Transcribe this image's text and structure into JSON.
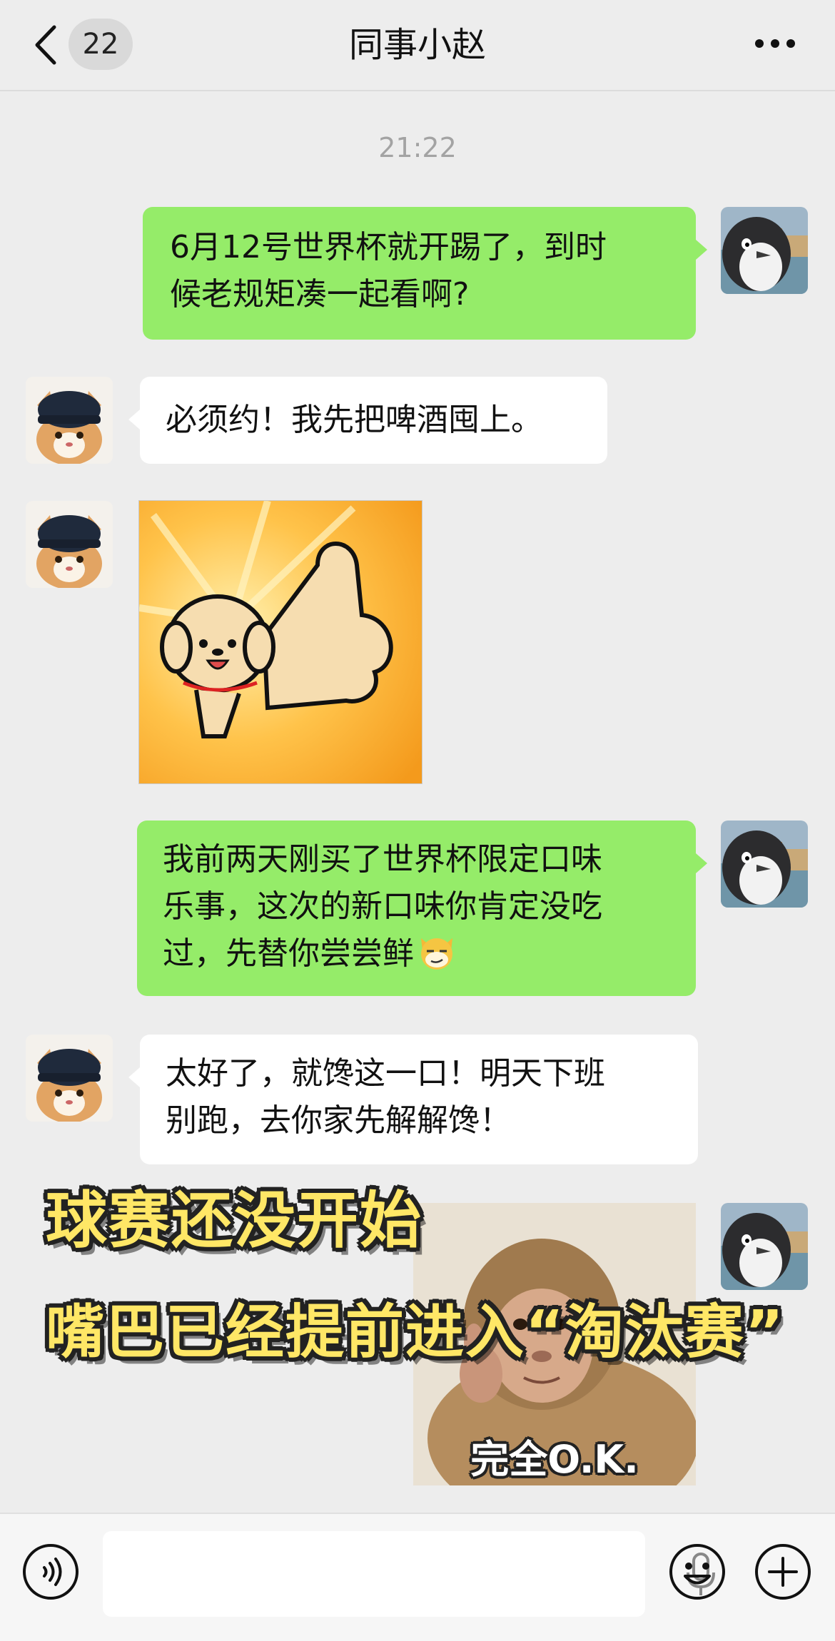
{
  "header": {
    "back_count": "22",
    "title": "同事小赵"
  },
  "timestamp": "21:22",
  "messages": [
    {
      "sender": "me",
      "text_line1": "6月12号世界杯就开踢了，到时",
      "text_line2": "候老规矩凑一起看啊?"
    },
    {
      "sender": "them",
      "text": "必须约！我先把啤酒囤上。"
    },
    {
      "sender": "them",
      "type": "sticker",
      "sticker": "thumbs-up-puppy"
    },
    {
      "sender": "me",
      "text_line1": "我前两天刚买了世界杯限定口味",
      "text_line2": "乐事，这次的新口味你肯定没吃",
      "text_line3": "过，先替你尝尝鲜",
      "emoji": "smirk-cat"
    },
    {
      "sender": "them",
      "text_line1": "太好了，就馋这一口！明天下班",
      "text_line2": "别跑，去你家先解解馋！"
    },
    {
      "sender": "me",
      "type": "sticker",
      "sticker": "thumbs-up-monkey",
      "caption": "完全O.K."
    }
  ],
  "overlay": {
    "line1": "球赛还没开始",
    "line2": "嘴巴已经提前进入“淘汰赛”"
  },
  "colors": {
    "my_bubble": "#95ec69",
    "their_bubble": "#ffffff",
    "background": "#ededed",
    "overlay_text": "#ffe766"
  },
  "bottom_bar": {
    "input_value": "",
    "icons": [
      "voice-icon",
      "microphone-icon",
      "emoji-icon",
      "plus-icon"
    ]
  }
}
